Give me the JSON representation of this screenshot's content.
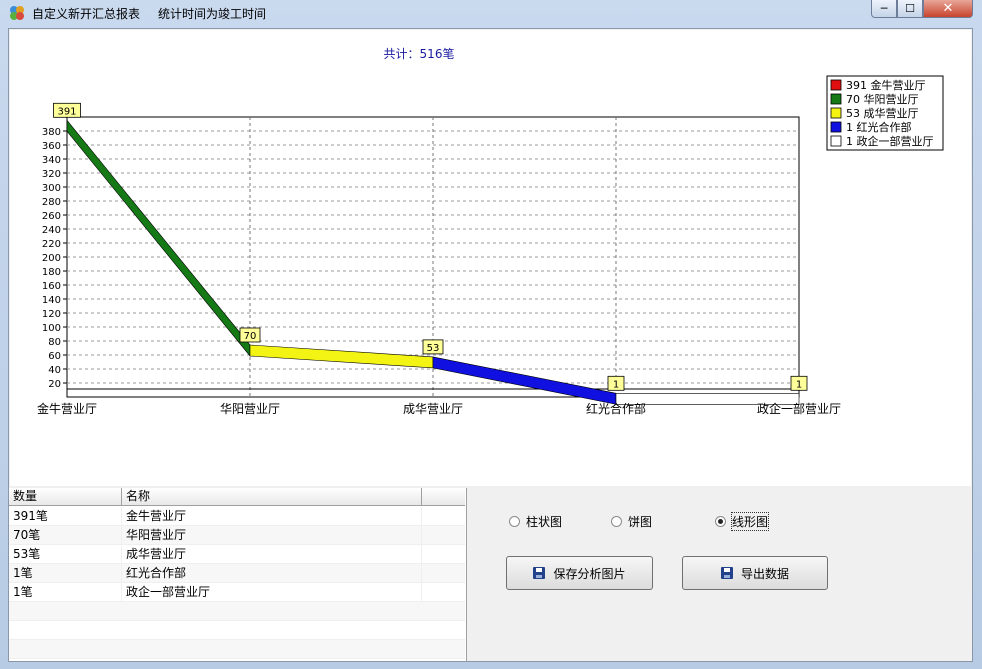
{
  "window": {
    "title": "自定义新开汇总报表",
    "subtitle": "统计时间为竣工时间",
    "min_glyph": "0",
    "max_glyph": "1",
    "close_glyph": "x"
  },
  "chart_data": {
    "type": "line",
    "title": "共计：516笔",
    "categories": [
      "金牛营业厅",
      "华阳营业厅",
      "成华营业厅",
      "红光合作部",
      "政企一部营业厅"
    ],
    "values": [
      391,
      70,
      53,
      1,
      1
    ],
    "data_labels": [
      "391",
      "70",
      "53",
      "1",
      "1"
    ],
    "ylim": [
      0,
      400
    ],
    "yticks": [
      20,
      40,
      60,
      80,
      100,
      120,
      140,
      160,
      180,
      200,
      220,
      240,
      260,
      280,
      300,
      320,
      340,
      360,
      380
    ],
    "grid": true,
    "legend_position": "top-right",
    "legend": [
      {
        "label": "391 金牛营业厅",
        "color": "#e01010"
      },
      {
        "label": "70 华阳营业厅",
        "color": "#157a15"
      },
      {
        "label": "53 成华营业厅",
        "color": "#f4f414"
      },
      {
        "label": "1 红光合作部",
        "color": "#1010e0"
      },
      {
        "label": "1 政企一部营业厅",
        "color": "#ffffff"
      }
    ],
    "segment_colors": [
      "#157a15",
      "#f4f414",
      "#1010e0",
      "#ffffff"
    ]
  },
  "table": {
    "headers": [
      "数量",
      "名称"
    ],
    "rows": [
      [
        "391笔",
        "金牛营业厅"
      ],
      [
        "70笔",
        "华阳营业厅"
      ],
      [
        "53笔",
        "成华营业厅"
      ],
      [
        "1笔",
        "红光合作部"
      ],
      [
        "1笔",
        "政企一部营业厅"
      ]
    ]
  },
  "options": {
    "radios": [
      {
        "label": "柱状图",
        "selected": false
      },
      {
        "label": "饼图",
        "selected": false
      },
      {
        "label": "线形图",
        "selected": true
      }
    ],
    "save_button": "保存分析图片",
    "export_button": "导出数据"
  }
}
